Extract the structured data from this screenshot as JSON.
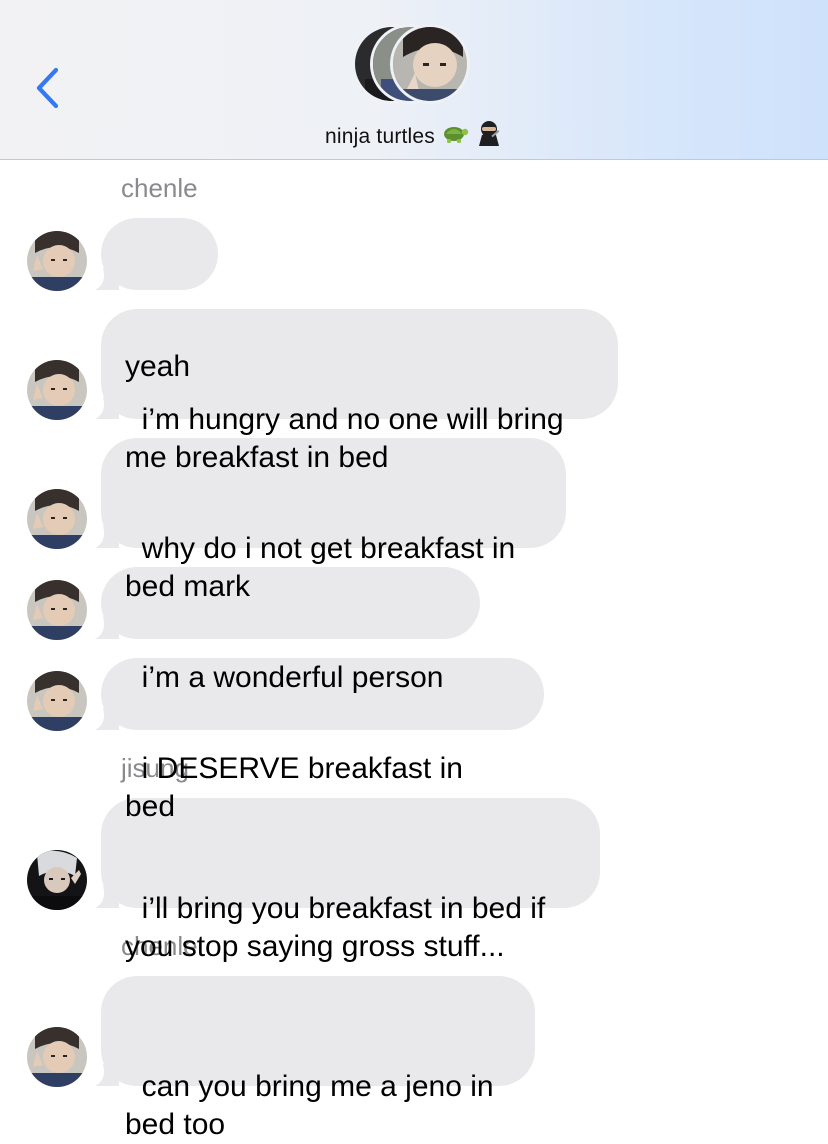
{
  "header": {
    "title": "ninja turtles",
    "emoji": [
      "turtle-emoji",
      "ninja-emoji"
    ]
  },
  "colors": {
    "accent": "#3478f6",
    "bubble_incoming": "#e9e9eb",
    "sender_label": "#8a8a8e"
  },
  "messages": [
    {
      "sender": "chenle"
    },
    {
      "text": "yeah"
    },
    {
      "text": "i’m hungry and no one will bring me breakfast in bed"
    },
    {
      "text": "why do i not get breakfast in bed mark"
    },
    {
      "text": "i’m a wonderful person"
    },
    {
      "text": "i DESERVE breakfast in bed"
    },
    {
      "sender": "jisung"
    },
    {
      "text": "i’ll bring you breakfast in bed if you stop saying gross stuff..."
    },
    {
      "sender": "chenle"
    },
    {
      "text": "can you bring me a jeno in bed too"
    }
  ]
}
